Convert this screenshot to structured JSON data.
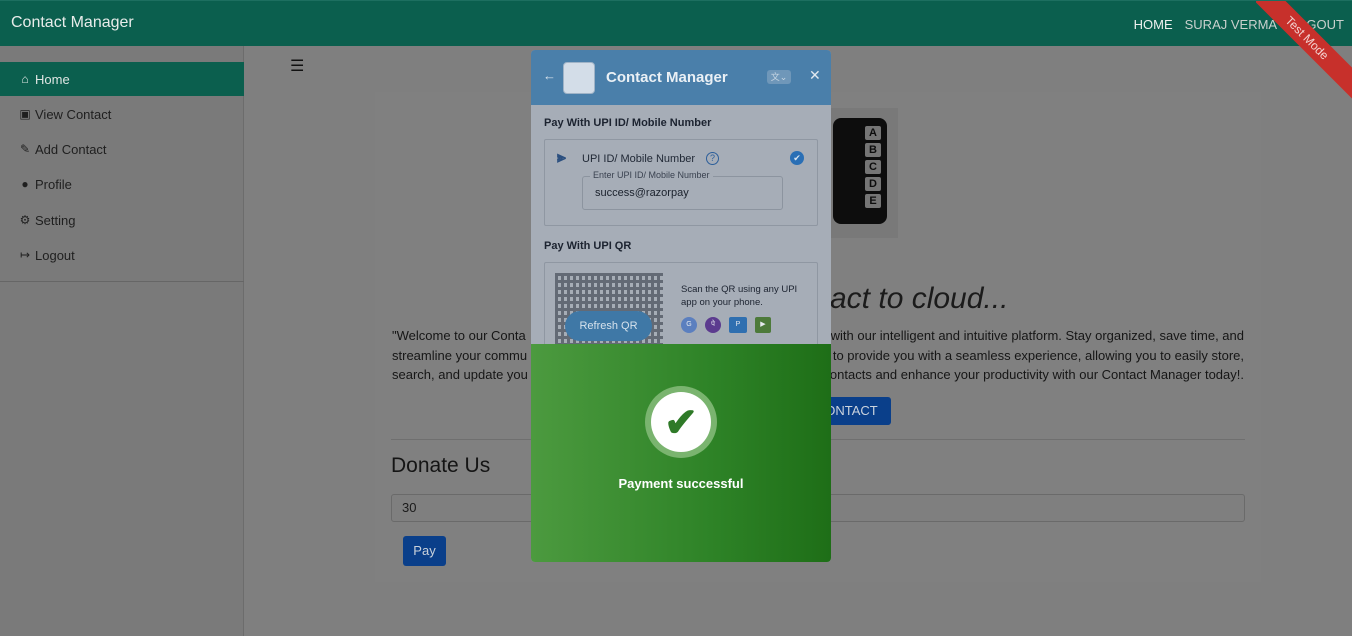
{
  "navbar": {
    "brand": "Contact Manager",
    "links": [
      "HOME",
      "SURAJ VERMA",
      "LOGOUT"
    ],
    "ribbon": "Test Mode"
  },
  "sidebar": {
    "items": [
      {
        "label": "Home",
        "icon": "home-icon",
        "active": true
      },
      {
        "label": "View Contact",
        "icon": "contact-card-icon"
      },
      {
        "label": "Add Contact",
        "icon": "pencil-icon"
      },
      {
        "label": "Profile",
        "icon": "user-icon"
      },
      {
        "label": "Setting",
        "icon": "gear-icon"
      },
      {
        "label": "Logout",
        "icon": "sign-out-icon"
      }
    ],
    "toggle_icon": "hamburger-icon"
  },
  "main": {
    "hero_title": "act to cloud...",
    "logo_letters": [
      "A",
      "B",
      "C",
      "D",
      "E"
    ],
    "welcome_text": "\"Welcome to our Conta... with our intelligent and intuitive platform. Stay organized, save time, and streamline your commun... to provide you with a seamless experience, allowing you to easily store, search, and update you... ontacts and enhance your productivity with our Contact Manager today!.",
    "welcome_lines": [
      "\"Welcome to our Conta",
      "with our intelligent and intuitive platform. Stay organized, save time, and",
      "streamline your commu",
      "to provide you with a seamless experience, allowing you to easily store,",
      "search, and update you",
      "ontacts and enhance your productivity with our Contact Manager today!."
    ],
    "contact_button": "ONTACT",
    "donate_title": "Donate Us",
    "amount_value": "30",
    "pay_button": "Pay"
  },
  "modal": {
    "merchant_name": "Contact Manager",
    "upi_section_title": "Pay With UPI ID/ Mobile Number",
    "upi_option_label": "UPI ID/ Mobile Number",
    "upi_field_label": "Enter UPI ID/ Mobile Number",
    "upi_field_value": "success@razorpay",
    "qr_section_title": "Pay With UPI QR",
    "refresh_qr": "Refresh QR",
    "qr_instruction": "Scan the QR using any UPI app on your phone.",
    "upi_apps": [
      "google-pay-icon",
      "phonepe-icon",
      "paytm-icon",
      "bhim-icon"
    ],
    "success_message": "Payment successful"
  },
  "colors": {
    "navbar": "#0b5f4e",
    "active_sidebar": "#0b5f4e",
    "primary_button": "#0a3f8a",
    "modal_header": "#4a7faa",
    "success_green": "#2e8327",
    "ribbon": "#c7302b"
  }
}
